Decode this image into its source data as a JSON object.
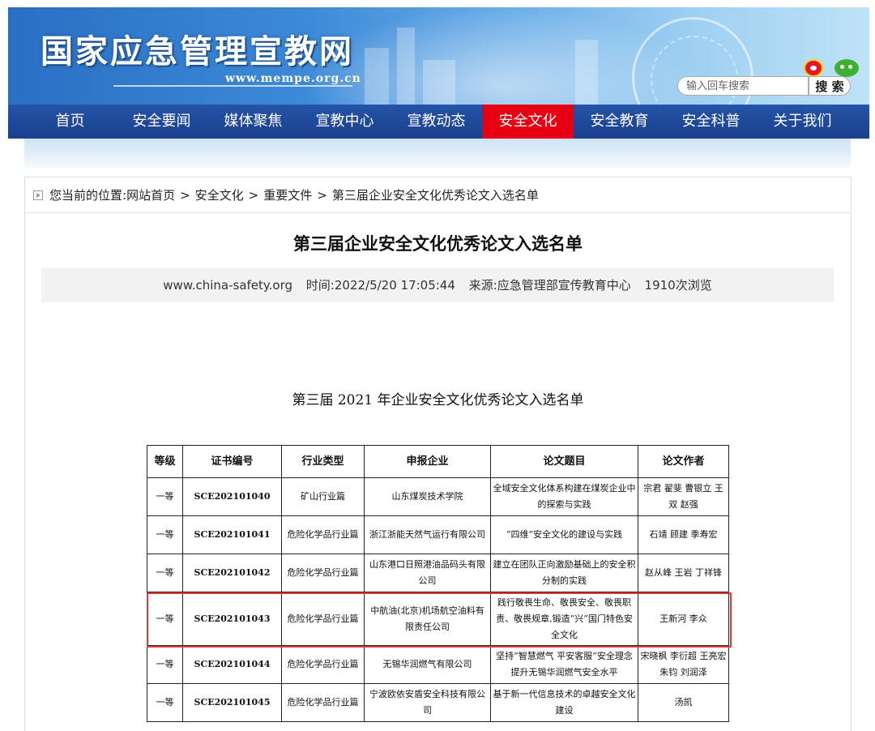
{
  "header": {
    "site_title": "国家应急管理宣教网",
    "site_url": "www.mempe.org.cn",
    "search_placeholder": "输入回车搜索",
    "search_button": "搜 索",
    "social_icons": [
      "weibo-icon",
      "wechat-icon"
    ]
  },
  "nav": {
    "items": [
      "首页",
      "安全要闻",
      "媒体聚焦",
      "宣教中心",
      "宣教动态",
      "安全文化",
      "安全教育",
      "安全科普",
      "关于我们"
    ],
    "active_index": 5,
    "active_color": "#e60012",
    "bar_color": "#1b3f8e"
  },
  "breadcrumb": {
    "prefix": "您当前的位置:",
    "items": [
      "网站首页",
      "安全文化",
      "重要文件",
      "第三届企业安全文化优秀论文入选名单"
    ],
    "separator": ">"
  },
  "article": {
    "title": "第三届企业安全文化优秀论文入选名单",
    "meta": {
      "site": "www.china-safety.org",
      "time": "时间:2022/5/20 17:05:44",
      "source": "来源:应急管理部宣传教育中心",
      "views": "1910次浏览"
    },
    "table_title": "第三届 2021 年企业安全文化优秀论文入选名单"
  },
  "table": {
    "headers": [
      "等级",
      "证书编号",
      "行业类型",
      "申报企业",
      "论文题目",
      "论文作者"
    ],
    "rows": [
      [
        "一等",
        "SCE202101040",
        "矿山行业篇",
        "山东煤炭技术学院",
        "全域安全文化体系构建在煤炭企业中的探索与实践",
        "宗君  翟斐  曹银立  王双  赵强"
      ],
      [
        "一等",
        "SCE202101041",
        "危险化学品行业篇",
        "浙江浙能天然气运行有限公司",
        "“四维”安全文化的建设与实践",
        "石靖  顾建  季寿宏"
      ],
      [
        "一等",
        "SCE202101042",
        "危险化学品行业篇",
        "山东港口日照港油品码头有限公司",
        "建立在团队正向激励基础上的安全积分制的实践",
        "赵从峰  王岩  丁祥锋"
      ],
      [
        "一等",
        "SCE202101043",
        "危险化学品行业篇",
        "中航油(北京)机场航空油料有限责任公司",
        "践行敬畏生命、敬畏安全、敬畏职责、敬畏规章,锻造“兴”国门特色安全文化",
        "王新河  李众"
      ],
      [
        "一等",
        "SCE202101044",
        "危险化学品行业篇",
        "无锡华润燃气有限公司",
        "坚持“智慧燃气 平安客服”安全理念 提升无锡华润燃气安全水平",
        "宋晓枫  李衍超  王亮宏  朱钧  刘润泽"
      ],
      [
        "一等",
        "SCE202101045",
        "危险化学品行业篇",
        "宁波欧依安盾安全科技有限公司",
        "基于新一代信息技术的卓越安全文化建设",
        "汤凯"
      ]
    ],
    "highlighted_row": 3,
    "highlight_color": "#e23b3b"
  }
}
